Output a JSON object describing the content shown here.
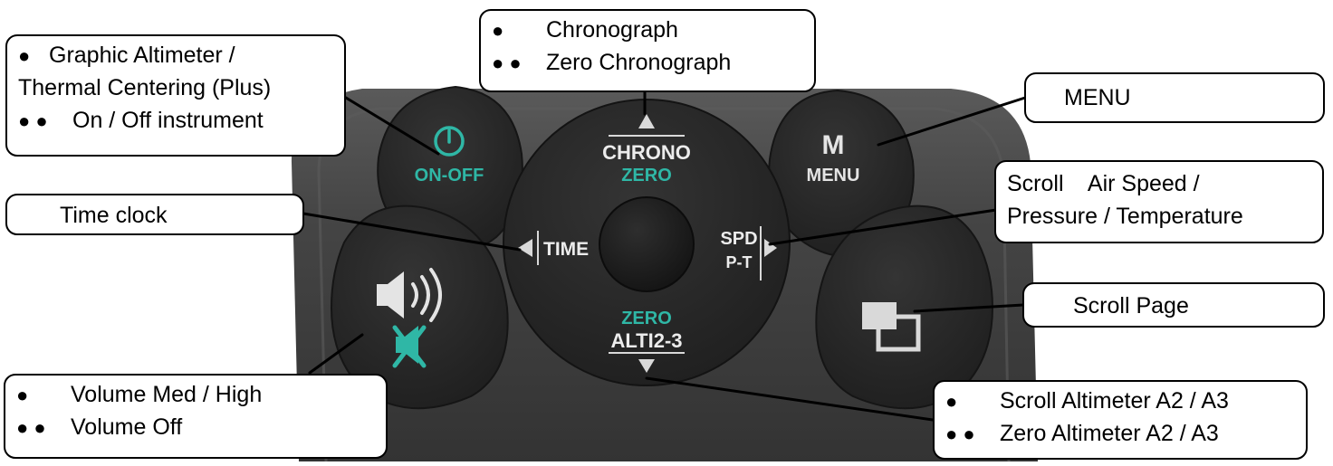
{
  "device": {
    "buttons": {
      "power": {
        "label": "ON-OFF",
        "icon": "power-icon"
      },
      "menu": {
        "symbol": "M",
        "label": "MENU"
      },
      "volume": {
        "icons": [
          "speaker-icon",
          "mute-icon"
        ]
      },
      "scroll_page": {
        "icon": "pages-icon"
      },
      "dpad": {
        "up": [
          "CHRONO",
          "ZERO"
        ],
        "left": "TIME",
        "right": [
          "SPD",
          "P-T"
        ],
        "down": [
          "ZERO",
          "ALTI2-3"
        ]
      }
    },
    "colors": {
      "accent": "#2fb7a6",
      "body": "#3d3d3d",
      "button": "#262626"
    }
  },
  "callouts": {
    "graphic_altimeter": {
      "lines": [
        {
          "bullets": "●",
          "text": "Graphic Altimeter /"
        },
        {
          "bullets": "",
          "text": "Thermal Centering (Plus)"
        },
        {
          "bullets": "● ●",
          "text": "On / Off instrument"
        }
      ]
    },
    "chronograph": {
      "lines": [
        {
          "bullets": "●",
          "text": "Chronograph"
        },
        {
          "bullets": "● ●",
          "text": "Zero Chronograph"
        }
      ]
    },
    "menu": {
      "text": "MENU"
    },
    "air_speed": {
      "lines": [
        "Scroll    Air Speed /",
        "Pressure / Temperature"
      ]
    },
    "time_clock": {
      "text": "Time clock"
    },
    "scroll_page": {
      "text": "Scroll Page"
    },
    "volume": {
      "lines": [
        {
          "bullets": "●",
          "text": "Volume Med / High"
        },
        {
          "bullets": "● ●",
          "text": "Volume Off"
        }
      ]
    },
    "altimeter": {
      "lines": [
        {
          "bullets": "●",
          "text": "Scroll Altimeter A2 / A3"
        },
        {
          "bullets": "● ●",
          "text": "Zero Altimeter A2 / A3"
        }
      ]
    }
  }
}
